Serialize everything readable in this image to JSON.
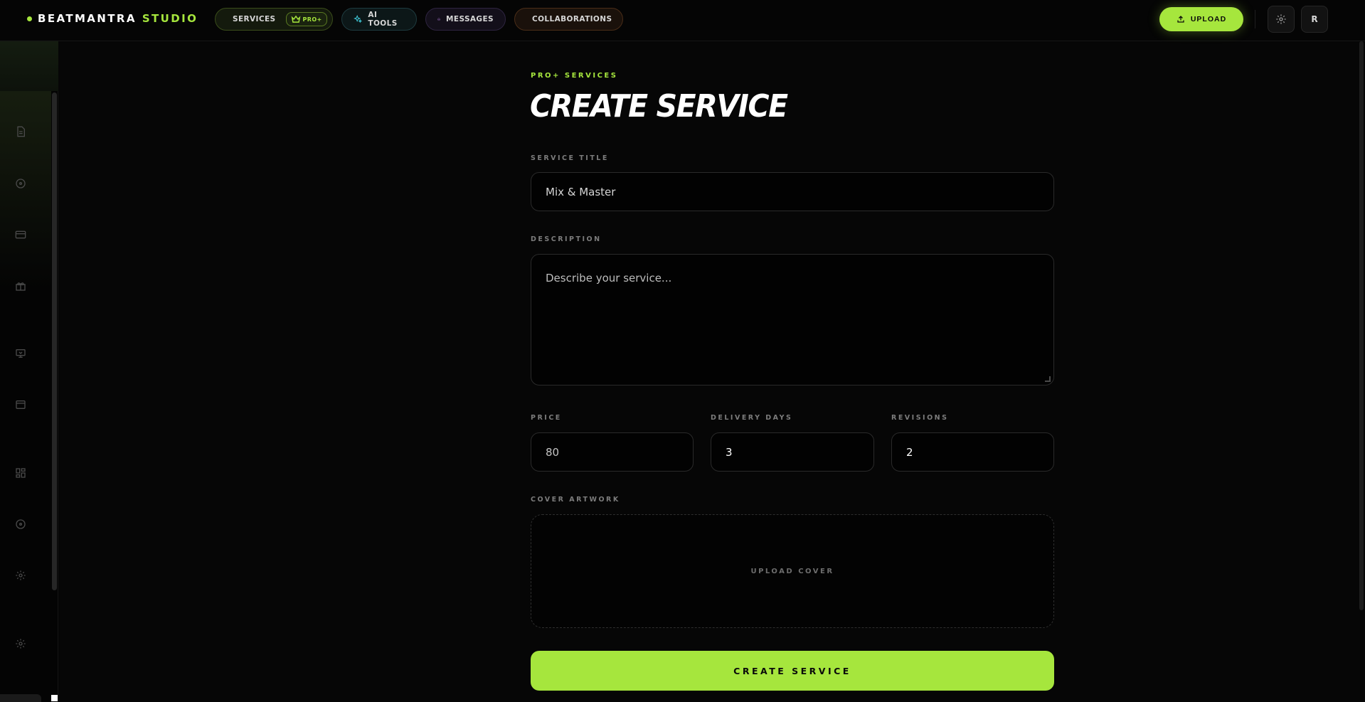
{
  "brand": {
    "name_part1": "BEATMANTRA",
    "name_part2": "STUDIO"
  },
  "nav": {
    "services": {
      "label": "SERVICES",
      "badge": "PRO+"
    },
    "ai_tools": {
      "label": "AI TOOLS"
    },
    "messages": {
      "label": "MESSAGES"
    },
    "collaborations": {
      "label": "COLLABORATIONS"
    }
  },
  "toolbar": {
    "upload_label": "UPLOAD",
    "avatar_initial": "R"
  },
  "sidebar": {
    "icons": [
      "document-icon",
      "disc-icon",
      "card-icon",
      "gift-icon",
      "presentation-icon",
      "archive-icon",
      "dashboard-icon",
      "disc-icon",
      "gear-icon",
      "gear-icon"
    ]
  },
  "form": {
    "eyebrow": "PRO+ SERVICES",
    "title": "CREATE SERVICE",
    "service_title": {
      "label": "SERVICE TITLE",
      "value": "Mix & Master"
    },
    "description": {
      "label": "DESCRIPTION",
      "placeholder": "Describe your service..."
    },
    "price": {
      "label": "PRICE",
      "value": "80"
    },
    "delivery_days": {
      "label": "DELIVERY DAYS",
      "value": "3"
    },
    "revisions": {
      "label": "REVISIONS",
      "value": "2"
    },
    "cover": {
      "label": "COVER ARTWORK",
      "upload_label": "UPLOAD COVER"
    },
    "submit_label": "CREATE SERVICE"
  },
  "colors": {
    "accent": "#a6e63d",
    "background": "#060606",
    "field_border": "#2a2a2a"
  }
}
